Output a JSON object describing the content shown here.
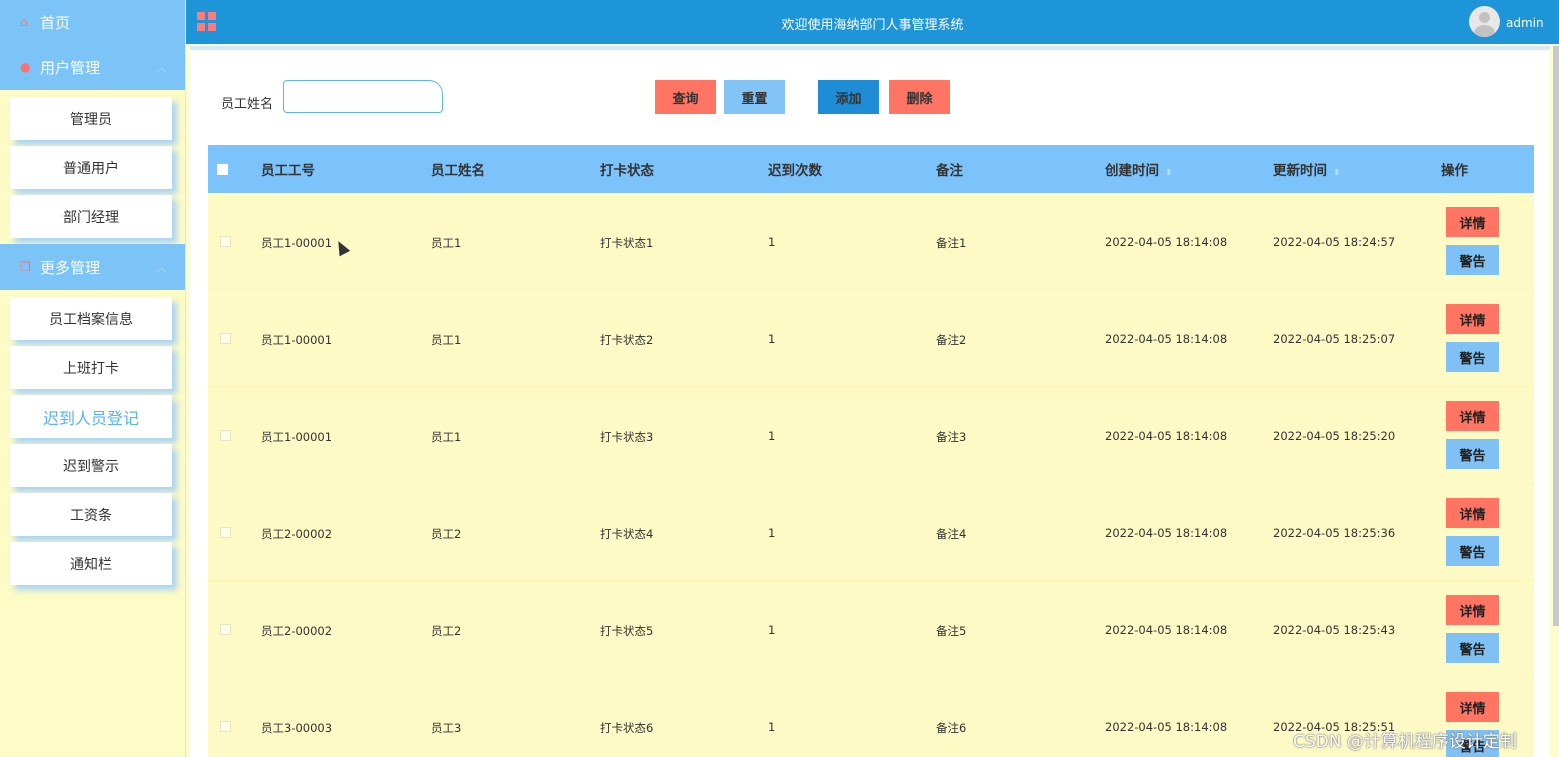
{
  "sidebar": {
    "home": "首页",
    "groups": [
      {
        "label": "用户管理",
        "items": [
          "管理员",
          "普通用户",
          "部门经理"
        ]
      },
      {
        "label": "更多管理",
        "items": [
          "员工档案信息",
          "上班打卡",
          "迟到人员登记",
          "迟到警示",
          "工资条",
          "通知栏"
        ]
      }
    ],
    "active_item": "迟到人员登记"
  },
  "topbar": {
    "title": "欢迎使用海纳部门人事管理系统",
    "user": "admin"
  },
  "search": {
    "label": "员工姓名",
    "value": "",
    "buttons": {
      "query": "查询",
      "reset": "重置",
      "add": "添加",
      "delete": "删除"
    }
  },
  "table": {
    "headers": [
      "员工工号",
      "员工姓名",
      "打卡状态",
      "迟到次数",
      "备注",
      "创建时间",
      "更新时间",
      "操作"
    ],
    "rows": [
      {
        "id": "员工1-00001",
        "name": "员工1",
        "status": "打卡状态1",
        "late": "1",
        "note": "备注1",
        "created": "2022-04-05 18:14:08",
        "updated": "2022-04-05 18:24:57"
      },
      {
        "id": "员工1-00001",
        "name": "员工1",
        "status": "打卡状态2",
        "late": "1",
        "note": "备注2",
        "created": "2022-04-05 18:14:08",
        "updated": "2022-04-05 18:25:07"
      },
      {
        "id": "员工1-00001",
        "name": "员工1",
        "status": "打卡状态3",
        "late": "1",
        "note": "备注3",
        "created": "2022-04-05 18:14:08",
        "updated": "2022-04-05 18:25:20"
      },
      {
        "id": "员工2-00002",
        "name": "员工2",
        "status": "打卡状态4",
        "late": "1",
        "note": "备注4",
        "created": "2022-04-05 18:14:08",
        "updated": "2022-04-05 18:25:36"
      },
      {
        "id": "员工2-00002",
        "name": "员工2",
        "status": "打卡状态5",
        "late": "1",
        "note": "备注5",
        "created": "2022-04-05 18:14:08",
        "updated": "2022-04-05 18:25:43"
      },
      {
        "id": "员工3-00003",
        "name": "员工3",
        "status": "打卡状态6",
        "late": "1",
        "note": "备注6",
        "created": "2022-04-05 18:14:08",
        "updated": "2022-04-05 18:25:51"
      }
    ],
    "row_actions": {
      "detail": "详情",
      "warn": "警告"
    }
  },
  "watermark": "CSDN @计算机程序设计定制",
  "colors": {
    "topbar": "#1e95d9",
    "sidebar_header": "#7cc3f8",
    "sidebar_bg": "#fdfbc6",
    "danger": "#ff7462",
    "primary": "#1f8dd6",
    "info": "#83c4f7"
  }
}
